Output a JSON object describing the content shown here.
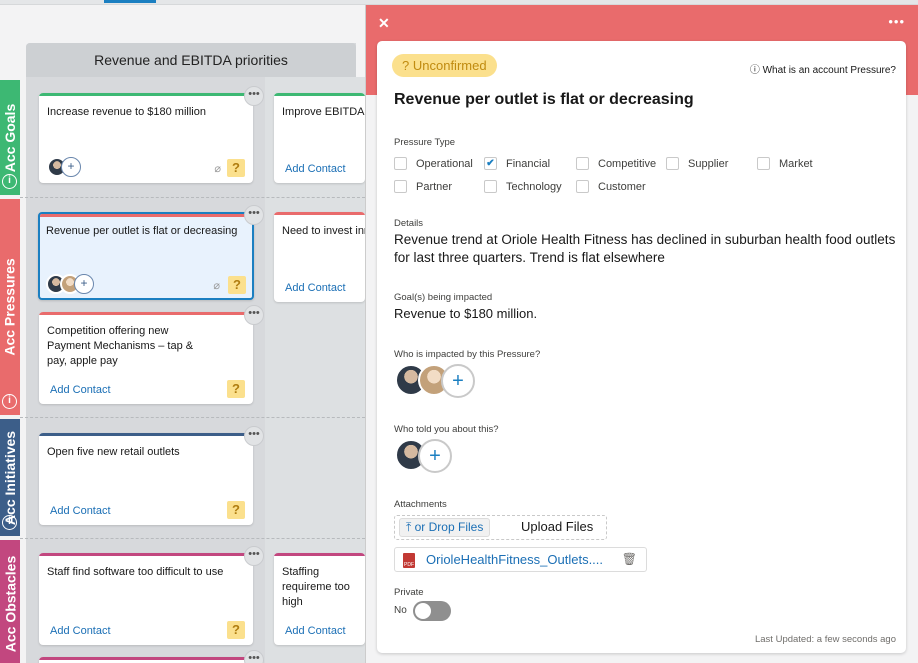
{
  "board": {
    "column_title": "Revenue and EBITDA priorities",
    "lanes": {
      "goals": "Acc Goals",
      "pressures": "Acc Pressures",
      "initiatives": "Acc Initiatives",
      "obstacles": "Acc Obstacles"
    },
    "info_glyph": "i",
    "dots": "•••",
    "add_contact": "Add Contact",
    "question": "?",
    "cards": {
      "goal1": "Increase revenue to $180 million",
      "goal2": "Improve EBITDA t",
      "press1": "Revenue per outlet is flat or decreasing",
      "press2": "Need to invest inr",
      "press3": "Competition offering new Payment Mechanisms – tap & pay, apple pay",
      "init1": "Open five new retail outlets",
      "obst1": "Staff find software too difficult to use",
      "obst2": "Staffing requireme too high"
    },
    "colors": {
      "goals": "#3db873",
      "pressures": "#e96b6c",
      "initiatives": "#3c5e89",
      "obstacles": "#c2477f",
      "selected": "#1b7fc1"
    }
  },
  "panel": {
    "close": "✕",
    "more": "•••",
    "status": "Unconfirmed",
    "status_icon": "?",
    "what_is": "What is an account Pressure?",
    "info_icon": "ⓘ",
    "title": "Revenue per outlet is flat or decreasing",
    "pressure_type_label": "Pressure Type",
    "types": {
      "operational": {
        "label": "Operational",
        "checked": false
      },
      "financial": {
        "label": "Financial",
        "checked": true
      },
      "competitive": {
        "label": "Competitive",
        "checked": false
      },
      "supplier": {
        "label": "Supplier",
        "checked": false
      },
      "market": {
        "label": "Market",
        "checked": false
      },
      "partner": {
        "label": "Partner",
        "checked": false
      },
      "technology": {
        "label": "Technology",
        "checked": false
      },
      "customer": {
        "label": "Customer",
        "checked": false
      }
    },
    "check_glyph": "✔",
    "details_label": "Details",
    "details": "Revenue trend at Oriole Health Fitness has declined in suburban health food outlets for last three quarters. Trend is flat elsewhere",
    "goals_label": "Goal(s) being impacted",
    "goals": "Revenue to $180 million.",
    "impacted_label": "Who is impacted by this Pressure?",
    "told_label": "Who told you about this?",
    "plus": "+",
    "attachments_label": "Attachments",
    "drop_files": "⤒ or Drop Files",
    "upload_files": "Upload Files",
    "file_name": "OrioleHealthFitness_Outlets....",
    "pdf_label": "PDF",
    "trash_icon": "🗑",
    "private_label": "Private",
    "private_value": "No",
    "private_on": false,
    "last_updated": "Last Updated: a few seconds ago"
  }
}
